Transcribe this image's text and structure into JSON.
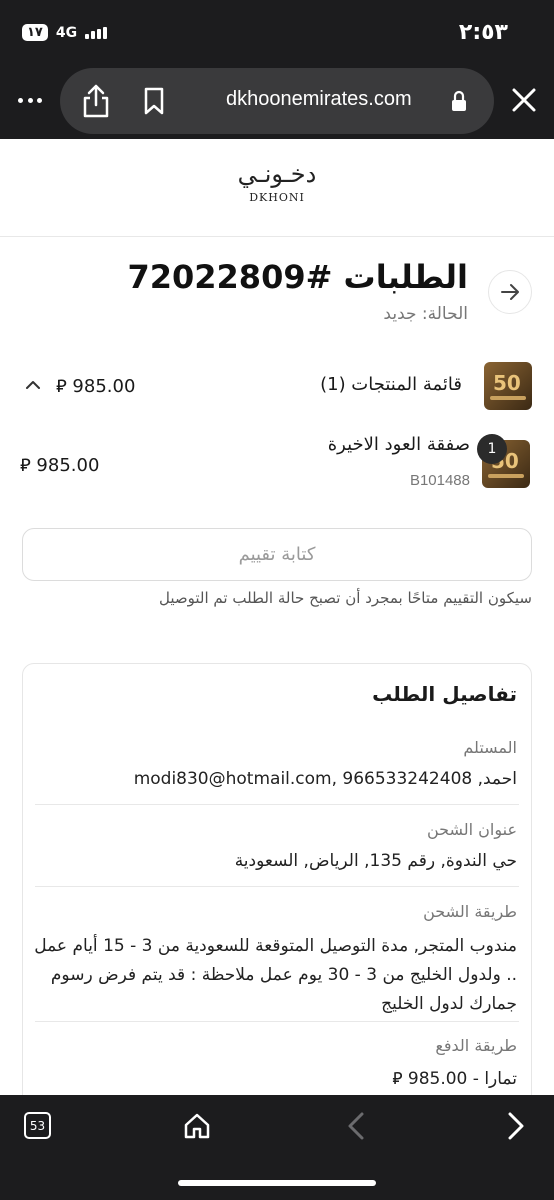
{
  "status_bar": {
    "time": "٢:٥٣",
    "battery": "١٧",
    "network": "4G"
  },
  "browser": {
    "url": "dkhoonemirates.com",
    "tabs_count": "53",
    "icons": {
      "more": "more-dots-icon",
      "share": "share-icon",
      "bookmark": "bookmark-icon",
      "lock": "lock-icon",
      "close": "close-icon",
      "home": "home-icon",
      "back": "chevron-left-icon",
      "forward": "chevron-right-icon"
    }
  },
  "site": {
    "logo_ar": "دخـونـي",
    "logo_en": "DKHONI"
  },
  "order": {
    "title": "الطلبات #72022809",
    "status": "الحالة: جديد"
  },
  "products": {
    "label": "قائمة المنتجات (1)",
    "total": "985.00 ⃁",
    "items": [
      {
        "quantity": "1",
        "name": "صفقة العود الاخيرة",
        "sku": "B101488",
        "price": "985.00 ⃁",
        "thumb_text": "50"
      }
    ]
  },
  "review": {
    "button_label": "كتابة تقييم",
    "note": "سيكون التقييم متاحًا بمجرد أن تصبح حالة الطلب تم التوصيل"
  },
  "details": {
    "title": "تفاصيل الطلب",
    "recipient_label": "المستلم",
    "recipient_value": "احمد, modi830@hotmail.com, 966533242408",
    "address_label": "عنوان الشحن",
    "address_value": "حي الندوة, رقم 135, الرياض, السعودية",
    "shipping_label": "طريقة الشحن",
    "shipping_value": "مندوب المتجر, مدة التوصيل المتوقعة للسعودية من 3 - 15 أيام عمل .. ولدول الخليج من 3 - 30 يوم عمل ملاحظة : قد يتم فرض رسوم جمارك لدول الخليج",
    "payment_label": "طريقة الدفع",
    "payment_value": "تمارا - 985.00 ⃁"
  },
  "colors": {
    "chrome_bg": "#1c1c1e",
    "url_pill": "#3a3a3c",
    "text": "#1a1a1a",
    "muted": "#777777"
  }
}
